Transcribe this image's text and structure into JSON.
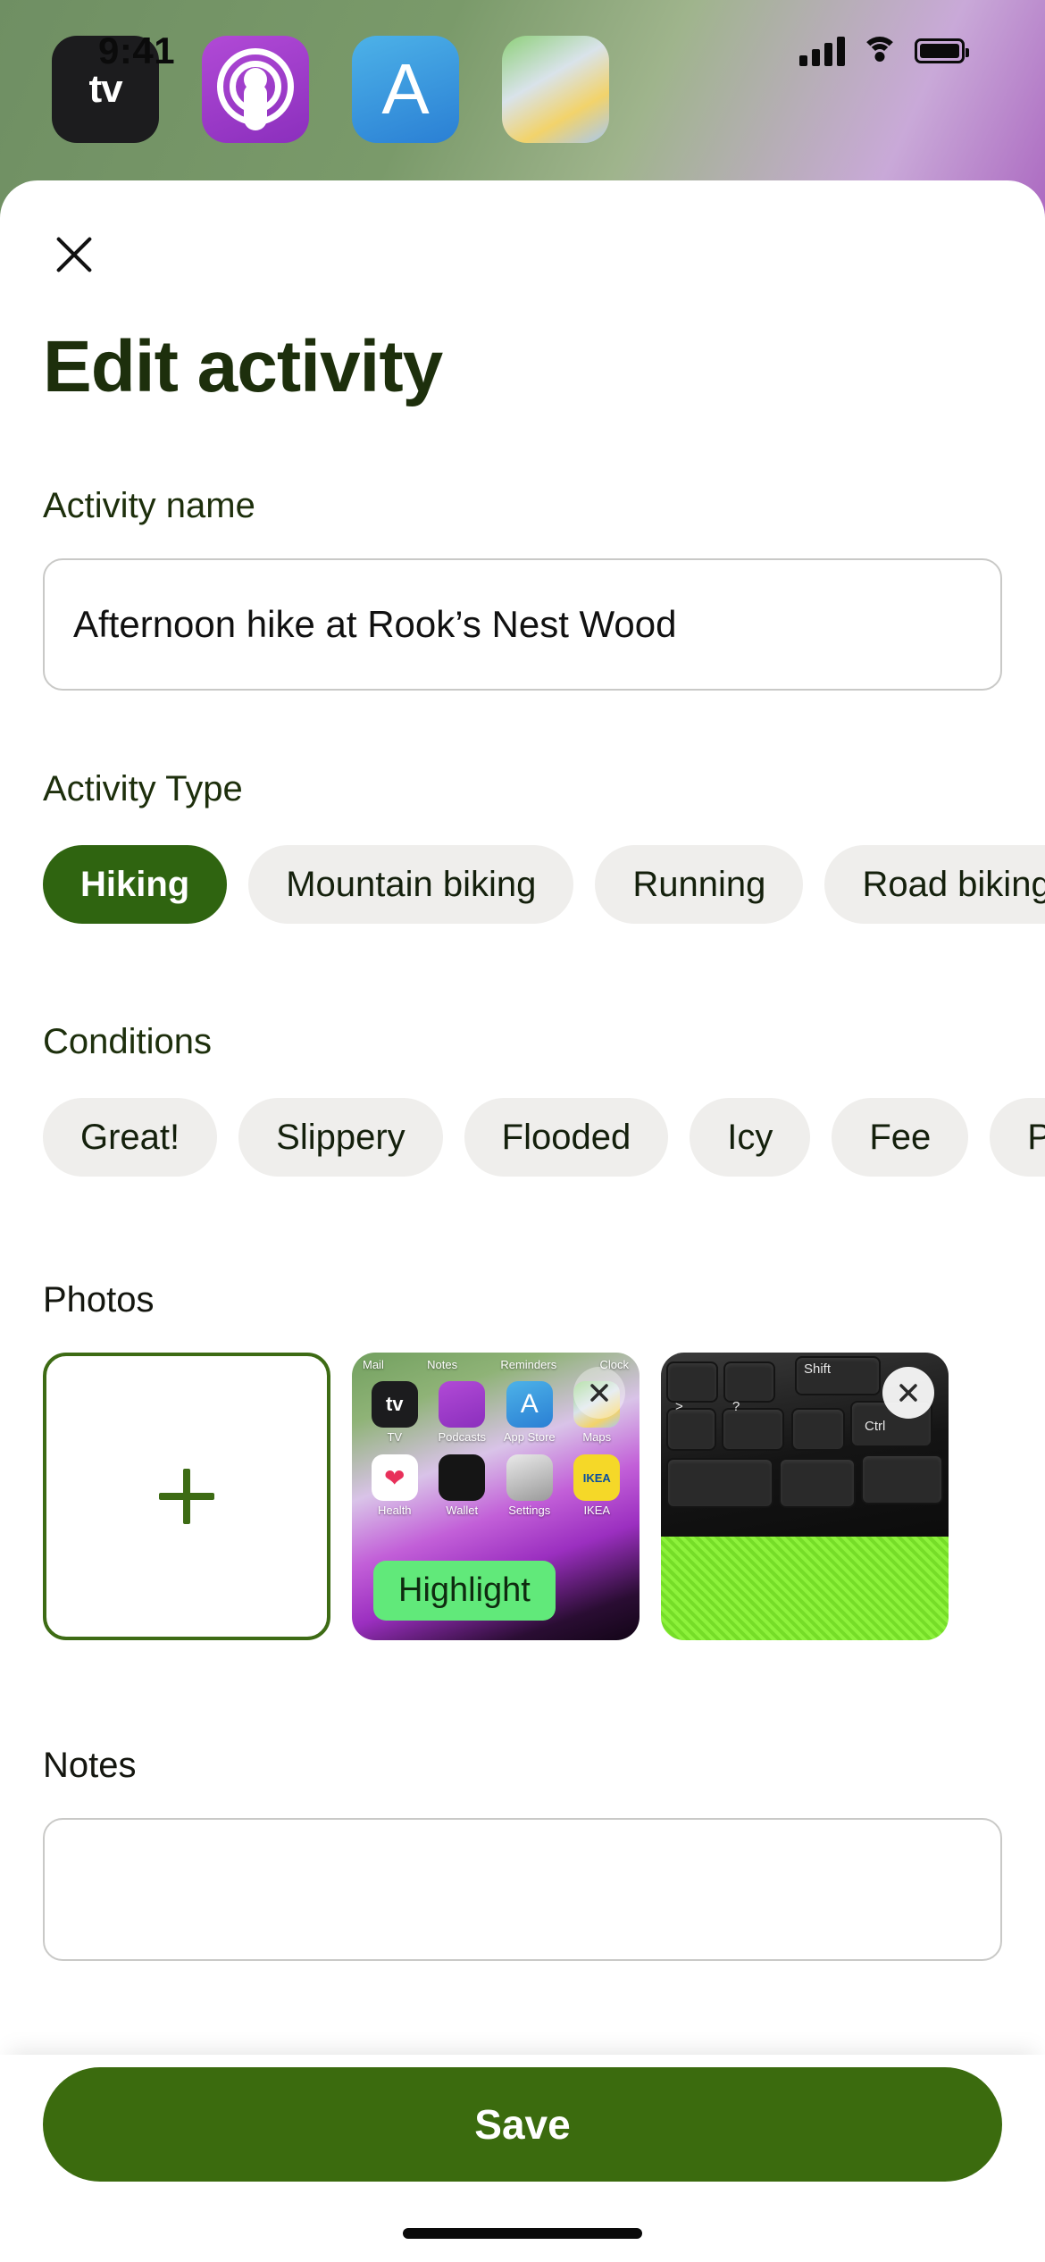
{
  "status_bar": {
    "time": "9:41",
    "signal_icon": "cellular-bars-icon",
    "wifi_icon": "wifi-icon",
    "battery_icon": "battery-full-icon"
  },
  "home_screen": {
    "dock_apps": [
      {
        "name": "TV",
        "label": "tv"
      },
      {
        "name": "Podcasts",
        "label": ""
      },
      {
        "name": "App Store",
        "label": "A"
      },
      {
        "name": "Maps",
        "label": ""
      }
    ]
  },
  "sheet": {
    "close_label": "×",
    "title": "Edit activity",
    "name_section": {
      "label": "Activity name",
      "value": "Afternoon hike at Rook’s Nest Wood",
      "placeholder": "Activity name"
    },
    "type_section": {
      "label": "Activity Type",
      "options": [
        {
          "label": "Hiking",
          "selected": true
        },
        {
          "label": "Mountain biking",
          "selected": false
        },
        {
          "label": "Running",
          "selected": false
        },
        {
          "label": "Road biking",
          "selected": false
        }
      ]
    },
    "conditions_section": {
      "label": "Conditions",
      "options": [
        {
          "label": "Great!",
          "selected": false
        },
        {
          "label": "Slippery",
          "selected": false
        },
        {
          "label": "Flooded",
          "selected": false
        },
        {
          "label": "Icy",
          "selected": false
        },
        {
          "label": "Fee",
          "selected": false
        },
        {
          "label": "Private",
          "selected": false
        }
      ]
    },
    "photos_section": {
      "label": "Photos",
      "add_icon": "plus-icon",
      "items": [
        {
          "kind": "add",
          "name": "add-photo-tile"
        },
        {
          "kind": "screenshot-home",
          "name": "photo-thumbnail-1",
          "badge": "Highlight",
          "remove_icon": "close-circle-icon",
          "inner_labels_top": [
            "Mail",
            "Notes",
            "Reminders",
            "Clock"
          ],
          "inner_apps_row1": [
            "TV",
            "Podcasts",
            "App Store",
            "Maps"
          ],
          "inner_apps_row2": [
            "Health",
            "Wallet",
            "Settings",
            "IKEA"
          ]
        },
        {
          "kind": "keyboard",
          "name": "photo-thumbnail-2",
          "remove_icon": "close-circle-icon",
          "key_labels": [
            "Shift",
            "Ctrl",
            ">",
            "?"
          ]
        }
      ]
    },
    "notes_section": {
      "label": "Notes",
      "value": "",
      "placeholder": ""
    }
  },
  "bottom_bar": {
    "save_label": "Save"
  },
  "colors": {
    "brand_green": "#3b6b0e",
    "chip_selected": "#2f6410",
    "chip_unselected": "#efeeec",
    "title_green": "#1d2f0c",
    "highlight_badge": "#61e97a",
    "border_grey": "#c9c9c7"
  }
}
